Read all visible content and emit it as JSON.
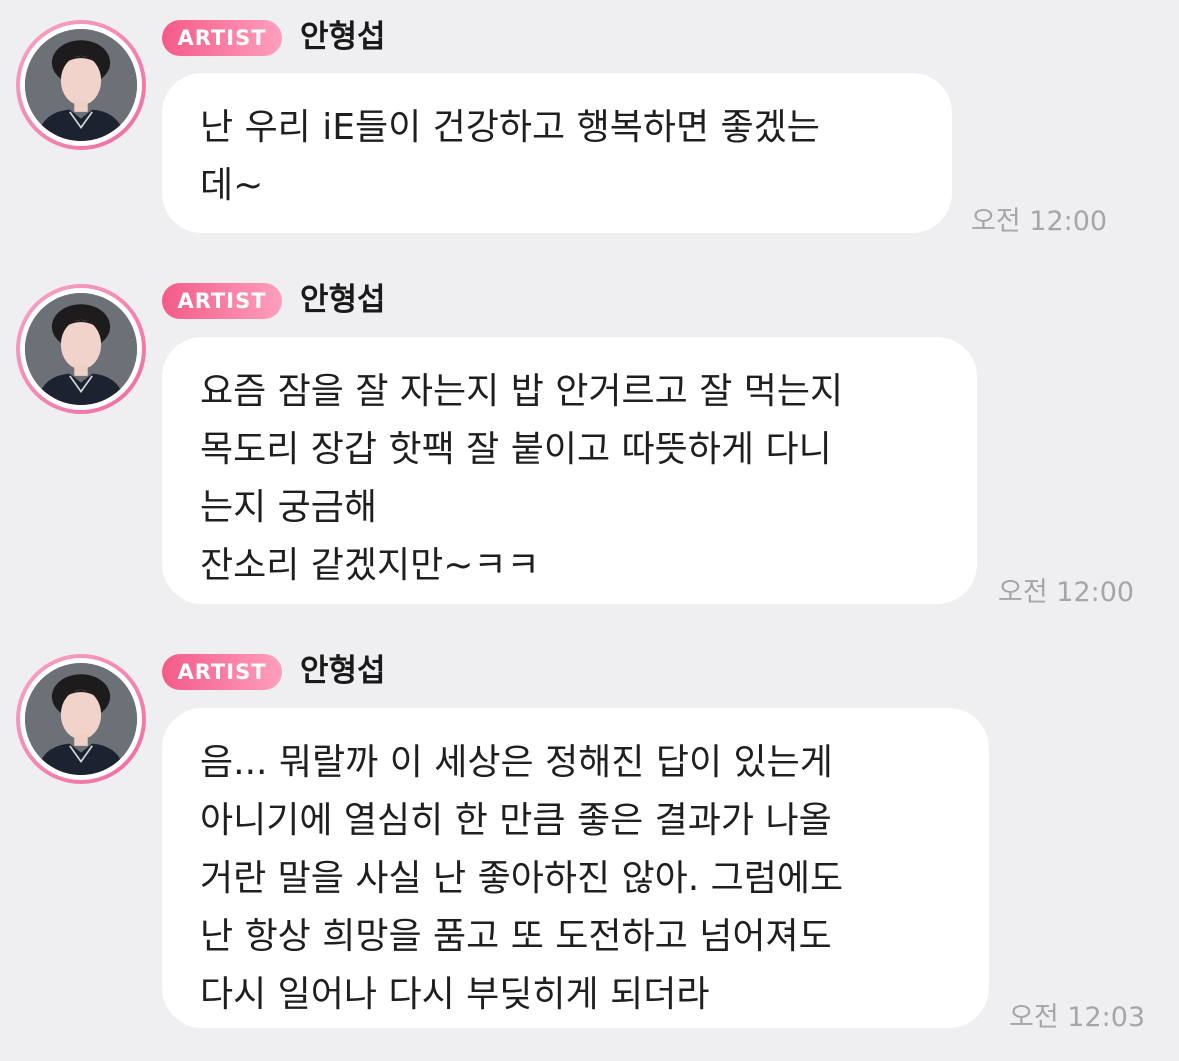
{
  "messages": [
    {
      "badge": "ARTIST",
      "sender": "안형섭",
      "text": "난 우리 iE들이 건강하고 행복하면 좋겠는\n데~",
      "time": "오전 12:00"
    },
    {
      "badge": "ARTIST",
      "sender": "안형섭",
      "text": "요즘 잠을 잘 자는지 밥 안거르고 잘 먹는지\n목도리 장갑 핫팩 잘 붙이고 따뜻하게 다니\n는지 궁금해\n잔소리 같겠지만~ㅋㅋ",
      "time": "오전 12:00"
    },
    {
      "badge": "ARTIST",
      "sender": "안형섭",
      "text": "음... 뭐랄까 이 세상은 정해진 답이 있는게\n아니기에 열심히 한 만큼 좋은 결과가 나올\n거란 말을 사실 난 좋아하진 않아. 그럼에도\n난 항상 희망을 품고 또 도전하고 넘어져도\n다시 일어나 다시 부딪히게 되더라",
      "time": "오전 12:03"
    }
  ],
  "colors": {
    "background": "#efeff2",
    "bubble": "#ffffff",
    "badge_start": "#f35b87",
    "badge_end": "#ff9fbd",
    "avatar_ring": "#f06aa0",
    "timestamp": "#a6a6aa"
  }
}
